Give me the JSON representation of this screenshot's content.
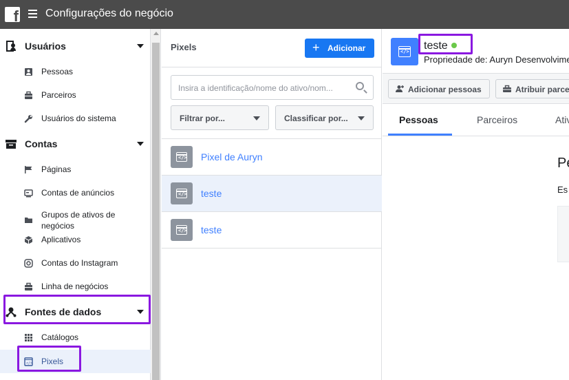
{
  "app": {
    "title": "Configurações do negócio",
    "logo_icon": "facebook-logo-icon",
    "menu_icon": "hamburger-menu-icon"
  },
  "sidebar": {
    "sections": [
      {
        "label": "Usuários",
        "icon": "users-icon",
        "items": [
          {
            "label": "Pessoas",
            "icon": "person-card-icon"
          },
          {
            "label": "Parceiros",
            "icon": "briefcase-icon"
          },
          {
            "label": "Usuários do sistema",
            "icon": "wrench-icon"
          }
        ]
      },
      {
        "label": "Contas",
        "icon": "archive-box-icon",
        "items": [
          {
            "label": "Páginas",
            "icon": "flag-icon"
          },
          {
            "label": "Contas de anúncios",
            "icon": "ad-account-icon"
          },
          {
            "label": "Grupos de ativos de negócios",
            "icon": "folder-icon"
          },
          {
            "label": "Aplicativos",
            "icon": "cube-icon"
          },
          {
            "label": "Contas do Instagram",
            "icon": "instagram-icon"
          },
          {
            "label": "Linha de negócios",
            "icon": "briefcase-icon"
          }
        ]
      },
      {
        "label": "Fontes de dados",
        "icon": "data-sources-icon",
        "items": [
          {
            "label": "Catálogos",
            "icon": "grid-icon"
          },
          {
            "label": "Pixels",
            "icon": "pixel-icon",
            "active": true
          }
        ]
      }
    ]
  },
  "pixels_panel": {
    "title": "Pixels",
    "add_label": "Adicionar",
    "search_placeholder": "Insira a identificação/nome do ativo/nom...",
    "filter_label": "Filtrar por...",
    "sort_label": "Classificar por...",
    "rows": [
      {
        "name": "Pixel de Auryn",
        "selected": false
      },
      {
        "name": "teste",
        "selected": true
      },
      {
        "name": "teste",
        "selected": false
      }
    ]
  },
  "detail": {
    "name": "teste",
    "status_color": "#6bc94a",
    "owner": "Propriedade de: Auryn Desenvolvime",
    "actions": {
      "add_people": "Adicionar pessoas",
      "assign_partner": "Atribuir parce"
    },
    "tabs": [
      "Pessoas",
      "Parceiros",
      "Ativ"
    ],
    "active_tab": "Pessoas",
    "body_heading": "Pe",
    "body_text": "Es"
  },
  "colors": {
    "topbar": "#4b4b4b",
    "accent": "#1877f2",
    "link": "#4080ff",
    "highlight": "#8a18e0",
    "selected_row": "#ebf1fb"
  }
}
